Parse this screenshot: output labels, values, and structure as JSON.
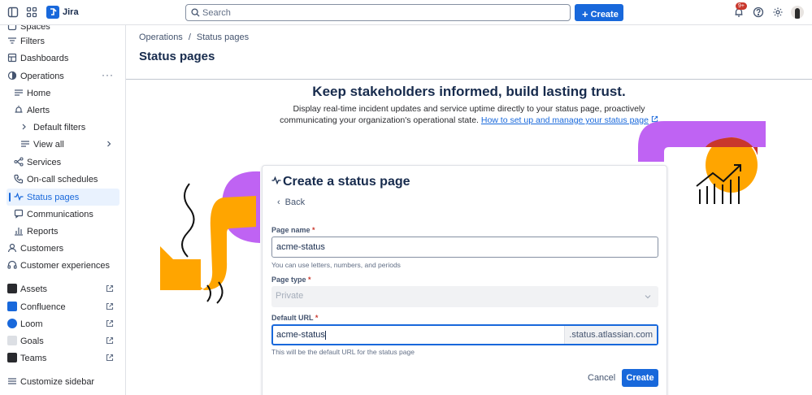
{
  "app": {
    "name": "Jira"
  },
  "topbar": {
    "search_placeholder": "Search",
    "create_label": "Create",
    "notifications_badge": "9+"
  },
  "sidebar": {
    "items": [
      {
        "label": "Spaces"
      },
      {
        "label": "Filters"
      },
      {
        "label": "Dashboards"
      },
      {
        "label": "Operations"
      },
      {
        "label": "Home"
      },
      {
        "label": "Alerts"
      },
      {
        "label": "Default filters"
      },
      {
        "label": "View all"
      },
      {
        "label": "Services"
      },
      {
        "label": "On-call schedules"
      },
      {
        "label": "Status pages"
      },
      {
        "label": "Communications"
      },
      {
        "label": "Reports"
      },
      {
        "label": "Customers"
      },
      {
        "label": "Customer experiences"
      },
      {
        "label": "Assets"
      },
      {
        "label": "Confluence"
      },
      {
        "label": "Loom"
      },
      {
        "label": "Goals"
      },
      {
        "label": "Teams"
      },
      {
        "label": "Customize sidebar"
      }
    ],
    "colors": {
      "active": "#1868db",
      "active_bg": "#e9f2fe"
    }
  },
  "main": {
    "breadcrumb": [
      "Operations",
      "Status pages"
    ],
    "page_title": "Status pages",
    "hero": {
      "title": "Keep stakeholders informed, build lasting trust.",
      "subtitle": "Display real-time incident updates and service uptime directly to your status page, proactively communicating your organization's operational state.",
      "link": "How to set up and manage your status page"
    }
  },
  "form": {
    "title": "Create a status page",
    "back_label": "Back",
    "page_name": {
      "label": "Page name",
      "required": "*",
      "value": "acme-status",
      "helper": "You can use letters, numbers, and periods"
    },
    "page_type": {
      "label": "Page type",
      "required": "*",
      "value": "Private"
    },
    "default_url": {
      "label": "Default URL",
      "required": "*",
      "value": "acme-status",
      "suffix": ".status.atlassian.com",
      "helper": "This will be the default URL for the status page"
    },
    "cancel_label": "Cancel",
    "submit_label": "Create"
  },
  "colors": {
    "brand": "#1868db",
    "illustration_orange": "#ffa500",
    "illustration_purple": "#bf63f3",
    "illustration_red": "#c9372c"
  }
}
